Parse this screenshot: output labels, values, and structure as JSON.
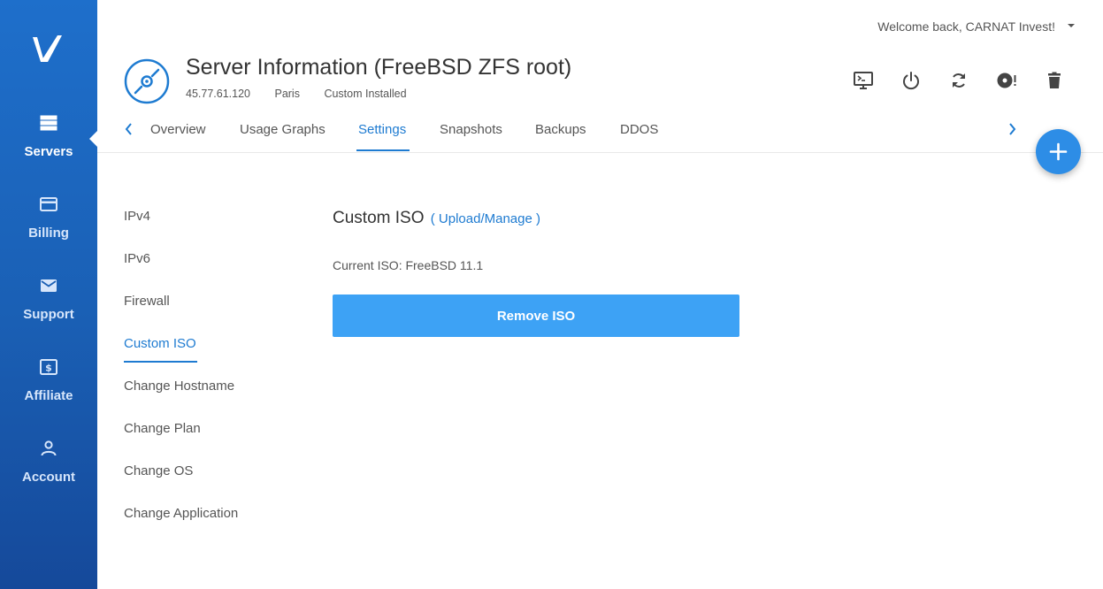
{
  "user": {
    "welcome": "Welcome back, CARNAT Invest!"
  },
  "sidebar": {
    "logo_icon": "vultr-logo",
    "items": [
      {
        "label": "Servers",
        "icon": "servers-icon",
        "active": true
      },
      {
        "label": "Billing",
        "icon": "billing-card-icon"
      },
      {
        "label": "Support",
        "icon": "envelope-icon"
      },
      {
        "label": "Affiliate",
        "icon": "affiliate-dollar-icon"
      },
      {
        "label": "Account",
        "icon": "user-icon"
      }
    ]
  },
  "server": {
    "title": "Server Information (FreeBSD ZFS root)",
    "ip": "45.77.61.120",
    "location": "Paris",
    "os": "Custom Installed",
    "icon": "disc-icon"
  },
  "actions": [
    {
      "name": "view-console-button",
      "icon": "monitor-icon"
    },
    {
      "name": "power-button",
      "icon": "power-icon"
    },
    {
      "name": "restart-button",
      "icon": "refresh-icon"
    },
    {
      "name": "reinstall-button",
      "icon": "disc-alert-icon"
    },
    {
      "name": "destroy-button",
      "icon": "trash-icon"
    }
  ],
  "tabs": [
    {
      "label": "Overview"
    },
    {
      "label": "Usage Graphs"
    },
    {
      "label": "Settings",
      "active": true
    },
    {
      "label": "Snapshots"
    },
    {
      "label": "Backups"
    },
    {
      "label": "DDOS"
    }
  ],
  "settings_menu": [
    {
      "label": "IPv4"
    },
    {
      "label": "IPv6"
    },
    {
      "label": "Firewall"
    },
    {
      "label": "Custom ISO",
      "active": true
    },
    {
      "label": "Change Hostname"
    },
    {
      "label": "Change Plan"
    },
    {
      "label": "Change OS"
    },
    {
      "label": "Change Application"
    }
  ],
  "custom_iso": {
    "title": "Custom ISO",
    "link": "( Upload/Manage )",
    "current": "Current ISO: FreeBSD 11.1",
    "remove_button": "Remove ISO"
  },
  "colors": {
    "accent": "#1e7bd1",
    "sidebar": "#1a5fb4",
    "button": "#3da2f5",
    "fab": "#2d8de6"
  }
}
